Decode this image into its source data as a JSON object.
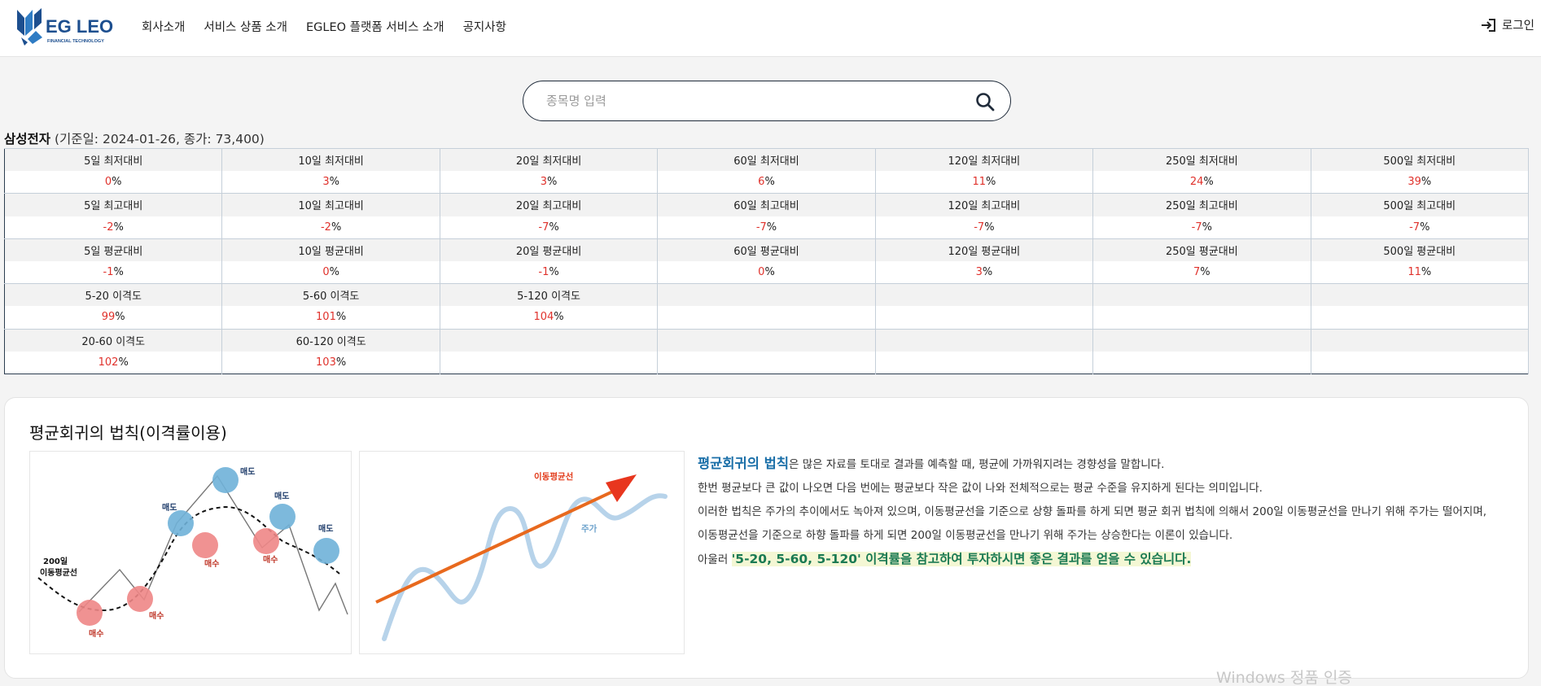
{
  "header": {
    "logo_text": "EG LEO",
    "logo_sub": "FINANCIAL TECHNOLOGY",
    "nav": [
      "회사소개",
      "서비스 상품 소개",
      "EGLEO 플랫폼 서비스 소개",
      "공지사항"
    ],
    "login_label": "로그인"
  },
  "search": {
    "placeholder": "종목명 입력"
  },
  "stock": {
    "name": "삼성전자",
    "info": "(기준일: 2024-01-26, 종가: 73,400)"
  },
  "table": {
    "rows": [
      {
        "headers": [
          "5일 최저대비",
          "10일 최저대비",
          "20일 최저대비",
          "60일 최저대비",
          "120일 최저대비",
          "250일 최저대비",
          "500일 최저대비"
        ],
        "values": [
          "0",
          "3",
          "3",
          "6",
          "11",
          "24",
          "39"
        ]
      },
      {
        "headers": [
          "5일 최고대비",
          "10일 최고대비",
          "20일 최고대비",
          "60일 최고대비",
          "120일 최고대비",
          "250일 최고대비",
          "500일 최고대비"
        ],
        "values": [
          "-2",
          "-2",
          "-7",
          "-7",
          "-7",
          "-7",
          "-7"
        ]
      },
      {
        "headers": [
          "5일 평균대비",
          "10일 평균대비",
          "20일 평균대비",
          "60일 평균대비",
          "120일 평균대비",
          "250일 평균대비",
          "500일 평균대비"
        ],
        "values": [
          "-1",
          "0",
          "-1",
          "0",
          "3",
          "7",
          "11"
        ]
      },
      {
        "headers": [
          "5-20 이격도",
          "5-60 이격도",
          "5-120 이격도",
          "",
          "",
          "",
          ""
        ],
        "values": [
          "99",
          "101",
          "104",
          "",
          "",
          "",
          ""
        ]
      },
      {
        "headers": [
          "20-60 이격도",
          "60-120 이격도",
          "",
          "",
          "",
          "",
          ""
        ],
        "values": [
          "102",
          "103",
          "",
          "",
          "",
          "",
          ""
        ]
      }
    ],
    "percent_sign": "%"
  },
  "card": {
    "title": "평균회귀의 법칙(이격률이용)",
    "chart1_labels": {
      "sell": "매도",
      "buy": "매수",
      "ma_line1": "200일",
      "ma_line2": "이동평균선"
    },
    "chart2_labels": {
      "ma": "이동평균선",
      "price": "주가"
    },
    "desc": {
      "p1_hl": "평균회귀의 법칙",
      "p1_rest": "은 많은 자료를 토대로 결과를 예측할 때, 평균에 가까워지려는 경향성을 말합니다.",
      "p2": "한번 평균보다 큰 값이 나오면 다음 번에는 평균보다 작은 값이 나와 전체적으로는 평균 수준을 유지하게 된다는 의미입니다.",
      "p3": "이러한 법칙은 주가의 추이에서도 녹아져 있으며, 이동평균선을 기준으로 상향 돌파를 하게 되면 평균 회귀 법칙에 의해서 200일 이동평균선을 만나기 위해 주가는 떨어지며,",
      "p4": "이동평균선을 기준으로 하향 돌파를 하게 되면 200일 이동평균선을 만나기 위해 주가는 상승한다는 이론이 있습니다.",
      "p5_pre": "아울러 ",
      "p5_hl": "'5-20, 5-60, 5-120' 이격률을 참고하여 투자하시면 좋은 결과를 얻을 수 있습니다."
    }
  },
  "watermark": "Windows 정품 인증",
  "colors": {
    "accent": "#1f2b3a",
    "negative": "#e0322c",
    "highlight": "#1a6fa8",
    "highlight_green": "#1a7a53"
  }
}
